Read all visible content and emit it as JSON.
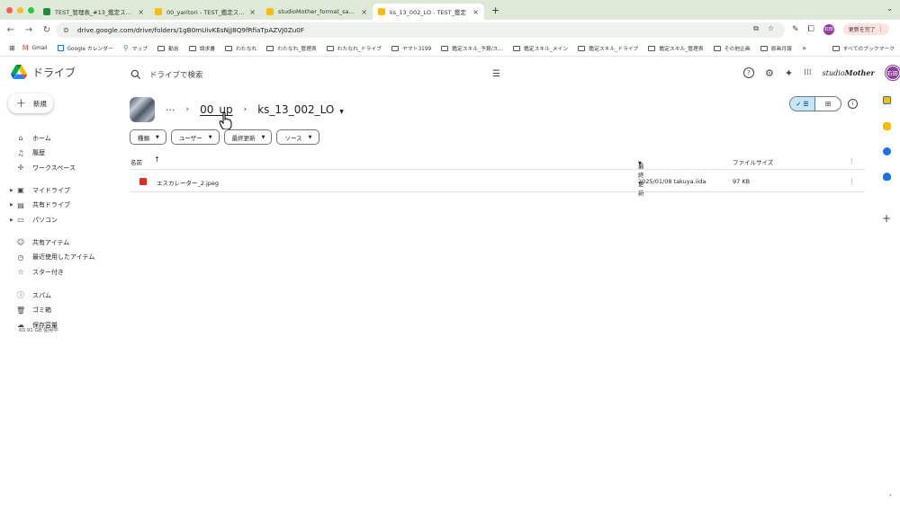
{
  "browser": {
    "tabs": [
      {
        "title": "TEST_管理表_#13_鑑定スキル",
        "active": false,
        "color": "#1e8e3e"
      },
      {
        "title": "00_yaritori - TEST_鑑定スキル",
        "active": false,
        "color": "#fbbc04"
      },
      {
        "title": "studioMother_format_sample",
        "active": false,
        "color": "#fbbc04"
      },
      {
        "title": "ks_13_002_LO - TEST_鑑定",
        "active": true,
        "color": "#fbbc04"
      }
    ],
    "url": "drive.google.com/drive/folders/1gB0mUivKEsNjJ8Q9fRfiaTpAZVJ0Zu0F",
    "profile_initials": "石田",
    "update_label": "更新を完了"
  },
  "bookmarks": [
    {
      "label": "Gmail",
      "icon": "gmail-icon"
    },
    {
      "label": "Google カレンダー",
      "icon": "calendar-icon"
    },
    {
      "label": "マップ",
      "icon": "maps-icon"
    },
    {
      "label": "勤怠",
      "icon": "folder-icon"
    },
    {
      "label": "請求書",
      "icon": "folder-icon"
    },
    {
      "label": "わたなれ",
      "icon": "folder-icon"
    },
    {
      "label": "わたなれ_管理表",
      "icon": "folder-icon"
    },
    {
      "label": "わたなれ_ドライブ",
      "icon": "folder-icon"
    },
    {
      "label": "ヤマト3199",
      "icon": "folder-icon"
    },
    {
      "label": "鑑定スキル_予算/ス...",
      "icon": "folder-icon"
    },
    {
      "label": "鑑定スキル_メイン",
      "icon": "folder-icon"
    },
    {
      "label": "鑑定スキル_ドライブ",
      "icon": "folder-icon"
    },
    {
      "label": "鑑定スキル_管理表",
      "icon": "folder-icon"
    },
    {
      "label": "その他企画",
      "icon": "folder-icon"
    },
    {
      "label": "原画月報",
      "icon": "folder-icon"
    }
  ],
  "bookmarks_more": "»",
  "all_bookmarks": "すべてのブックマーク",
  "drive": {
    "title": "ドライブ",
    "search_placeholder": "ドライブで検索",
    "brand": "Mother",
    "new_label": "新規"
  },
  "sidebar": {
    "group1": [
      {
        "label": "ホーム",
        "icon": "home-icon",
        "glyph": "⌂"
      },
      {
        "label": "履歴",
        "icon": "bell-icon",
        "glyph": "♫"
      },
      {
        "label": "ワークスペース",
        "icon": "workspace-icon",
        "glyph": "✢"
      }
    ],
    "group2": [
      {
        "label": "マイドライブ",
        "icon": "my-drive-icon",
        "glyph": "▣"
      },
      {
        "label": "共有ドライブ",
        "icon": "shared-drive-icon",
        "glyph": "▤"
      },
      {
        "label": "パソコン",
        "icon": "computer-icon",
        "glyph": "▭"
      }
    ],
    "group3": [
      {
        "label": "共有アイテム",
        "icon": "shared-icon",
        "glyph": "☺"
      },
      {
        "label": "最近使用したアイテム",
        "icon": "clock-icon",
        "glyph": "◷"
      },
      {
        "label": "スター付き",
        "icon": "star-icon",
        "glyph": "☆"
      }
    ],
    "group4": [
      {
        "label": "スパム",
        "icon": "spam-icon",
        "glyph": "ⓘ"
      },
      {
        "label": "ゴミ箱",
        "icon": "trash-icon",
        "glyph": "🗑"
      },
      {
        "label": "保存容量",
        "icon": "cloud-icon",
        "glyph": "☁"
      }
    ],
    "storage_text": "60.91 GB 使用中"
  },
  "breadcrumb": {
    "dots": "···",
    "parent": "00_up",
    "current": "ks_13_002_LO"
  },
  "filters": [
    {
      "label": "種類"
    },
    {
      "label": "ユーザー"
    },
    {
      "label": "最終更新"
    },
    {
      "label": "ソース"
    }
  ],
  "table": {
    "col_name": "名前",
    "col_modified": "最終更新",
    "col_size": "ファイルサイズ",
    "rows": [
      {
        "name": "エスカレーター_2.jpeg",
        "modified": "2025/01/08 takuya.iida",
        "size": "97 KB"
      }
    ]
  }
}
